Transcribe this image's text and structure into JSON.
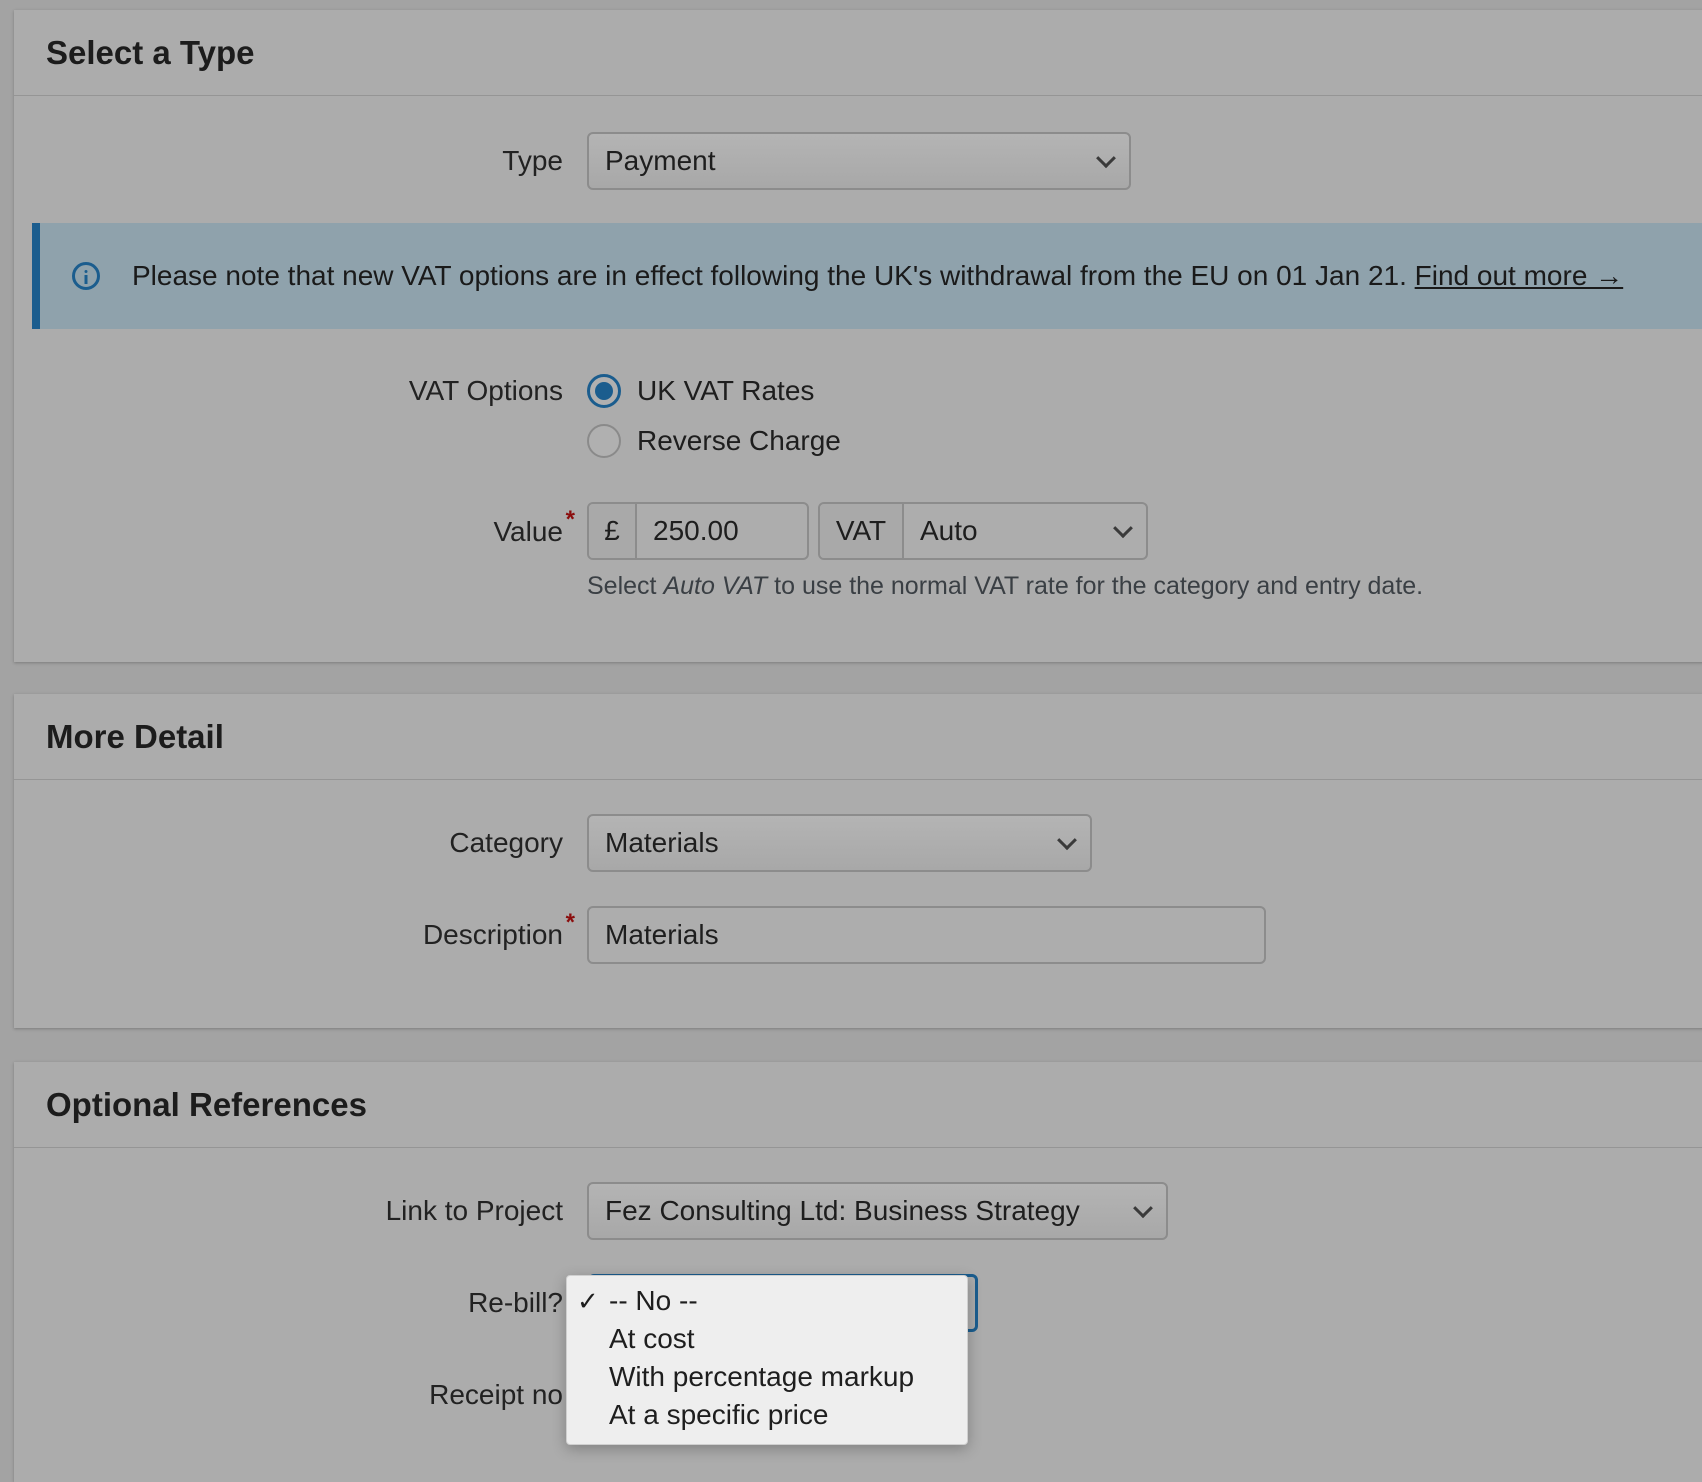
{
  "sections": {
    "select_type": {
      "title": "Select a Type",
      "type_label": "Type",
      "type_value": "Payment",
      "notice": {
        "text": "Please note that new VAT options are in effect following the UK's withdrawal from the EU on 01 Jan 21.",
        "link": "Find out more →"
      },
      "vat_options_label": "VAT Options",
      "vat_options": [
        {
          "label": "UK VAT Rates",
          "checked": true
        },
        {
          "label": "Reverse Charge",
          "checked": false
        }
      ],
      "value_label": "Value",
      "required_mark": "*",
      "currency_symbol": "£",
      "value": "250.00",
      "vat_addon": "VAT",
      "vat_value": "Auto",
      "help_prefix": "Select ",
      "help_em": "Auto VAT",
      "help_suffix": " to use the normal VAT rate for the category and entry date."
    },
    "more_detail": {
      "title": "More Detail",
      "category_label": "Category",
      "category_value": "Materials",
      "description_label": "Description",
      "description_value": "Materials"
    },
    "optional_references": {
      "title": "Optional References",
      "project_label": "Link to Project",
      "project_value": "Fez Consulting Ltd: Business Strategy",
      "rebill_label": "Re-bill?",
      "receipt_label": "Receipt no",
      "rebill_options": [
        {
          "label": "-- No --",
          "selected": true
        },
        {
          "label": "At cost",
          "selected": false
        },
        {
          "label": "With percentage markup",
          "selected": false
        },
        {
          "label": "At a specific price",
          "selected": false
        }
      ],
      "check_mark": "✓"
    }
  },
  "colors": {
    "accent": "#1b5d8e",
    "required": "#8b0d0d",
    "notice_bg": "#8fa2ac"
  }
}
